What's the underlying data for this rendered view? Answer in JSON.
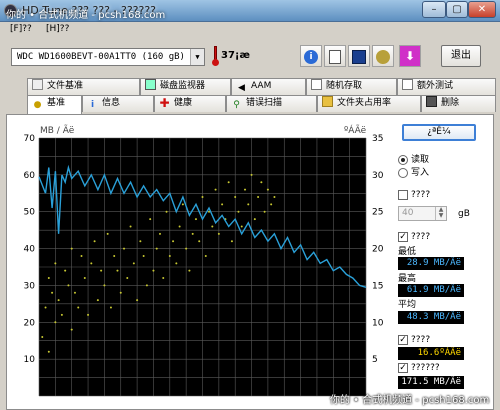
{
  "window": {
    "title": "HD Tune ??? ??? - ??????",
    "watermark": "你的 • 合式机频道 - pcsh168.com",
    "min_label": "–",
    "max_label": "▢",
    "close_label": "✕"
  },
  "menu": {
    "file": "[F]??",
    "help": "[H]??"
  },
  "toolbar": {
    "drive": "WDC WD1600BEVT-00A1TT0 (160 gB)",
    "temperature": "37¡æ",
    "exit_label": "退出",
    "buttons": [
      "info",
      "copy",
      "save",
      "options",
      "download"
    ]
  },
  "tabs_row1": [
    {
      "label": "文件基准",
      "icon": "file-icon"
    },
    {
      "label": "磁盘监视器",
      "icon": "monitor-icon"
    },
    {
      "label": "AAM",
      "icon": "speaker-icon"
    },
    {
      "label": "随机存取",
      "icon": "chart-icon"
    },
    {
      "label": "额外测试",
      "icon": "list-icon"
    }
  ],
  "tabs_row2": [
    {
      "label": "基准",
      "icon": "bulb-icon",
      "active": true
    },
    {
      "label": "信息",
      "icon": "info-icon"
    },
    {
      "label": "健康",
      "icon": "cross-icon"
    },
    {
      "label": "错误扫描",
      "icon": "magnifier-icon"
    },
    {
      "label": "文件夹占用率",
      "icon": "folder-icon"
    },
    {
      "label": "删除",
      "icon": "trash-icon"
    }
  ],
  "side": {
    "test_label": "¿ªÊ¼",
    "read_label": "读取",
    "write_label": "写入",
    "short_check": "????",
    "spin_value": "40",
    "spin_unit": "gB",
    "speed_check": "????",
    "min_label": "最低",
    "min_value": "28.9 MB/Ãë",
    "max_label": "最高",
    "max_value": "61.9 MB/Ãë",
    "avg_label": "平均",
    "avg_value": "48.3 MB/Ãë",
    "access_check": "????",
    "access_value": "16.6ºÁÃë",
    "burst_check": "??????",
    "burst_value": "171.5 MB/Ãë"
  },
  "colors": {
    "chart_bg": "#000000",
    "grid": "#5a5a5a",
    "transfer_line": "#2aa0d8",
    "access_dots": "#c8c832"
  },
  "chart_data": {
    "type": "line",
    "ylabel_left": "MB / Ãë",
    "ylabel_right": "ºÁÃë",
    "ylim_left": [
      0,
      70
    ],
    "ylim_right": [
      0,
      35
    ],
    "left_ticks": [
      "70",
      "60",
      "50",
      "40",
      "30",
      "20",
      "10"
    ],
    "right_ticks": [
      "35",
      "30",
      "25",
      "20",
      "15",
      "10",
      "5"
    ],
    "grid": true,
    "series": [
      {
        "axis": "left",
        "x": [
          0,
          2,
          3,
          4,
          5,
          6,
          7,
          8,
          9,
          10,
          12,
          14,
          16,
          18,
          20,
          22,
          24,
          26,
          28,
          30,
          32,
          34,
          36,
          38,
          40,
          42,
          44,
          46,
          48,
          50,
          52,
          54,
          56,
          58,
          60,
          62,
          64,
          66,
          68,
          70,
          72,
          74,
          76,
          78,
          80,
          82,
          84,
          86,
          88,
          90,
          92,
          94,
          96,
          98,
          100
        ],
        "values": [
          59.5,
          55,
          62,
          51,
          61,
          44,
          60,
          58,
          62,
          59,
          61,
          57,
          60,
          56,
          60,
          55,
          59,
          55,
          58,
          54,
          57,
          54,
          56,
          53,
          55,
          50,
          54,
          49,
          52,
          48,
          51,
          47,
          49,
          46,
          48,
          44,
          47,
          43,
          45,
          42,
          44,
          40,
          43,
          39,
          41,
          37,
          39,
          36,
          37,
          34,
          35,
          33,
          32,
          30,
          29.5
        ]
      },
      {
        "axis": "right",
        "type": "scatter",
        "x": [
          1,
          2,
          3,
          3,
          4,
          5,
          5,
          6,
          7,
          8,
          9,
          10,
          10,
          11,
          12,
          13,
          14,
          15,
          16,
          17,
          18,
          19,
          20,
          21,
          22,
          23,
          24,
          25,
          26,
          27,
          28,
          29,
          30,
          31,
          32,
          33,
          34,
          35,
          36,
          37,
          38,
          39,
          40,
          41,
          42,
          43,
          44,
          45,
          46,
          47,
          48,
          49,
          50,
          51,
          52,
          53,
          54,
          55,
          56,
          57,
          58,
          59,
          60,
          61,
          62,
          63,
          64,
          65,
          66,
          67,
          68,
          69,
          70,
          71,
          72
        ],
        "values": [
          8,
          12,
          16,
          6,
          14,
          10,
          18,
          13,
          11,
          17,
          15,
          9,
          20,
          14,
          12,
          19,
          16,
          11,
          18,
          21,
          13,
          17,
          15,
          22,
          12,
          19,
          17,
          14,
          20,
          16,
          23,
          18,
          13,
          21,
          19,
          15,
          24,
          17,
          20,
          22,
          16,
          25,
          19,
          21,
          18,
          23,
          26,
          20,
          17,
          22,
          24,
          21,
          27,
          19,
          25,
          23,
          28,
          22,
          26,
          24,
          29,
          21,
          27,
          25,
          23,
          28,
          26,
          30,
          24,
          27,
          29,
          25,
          28,
          26,
          27
        ]
      }
    ]
  }
}
